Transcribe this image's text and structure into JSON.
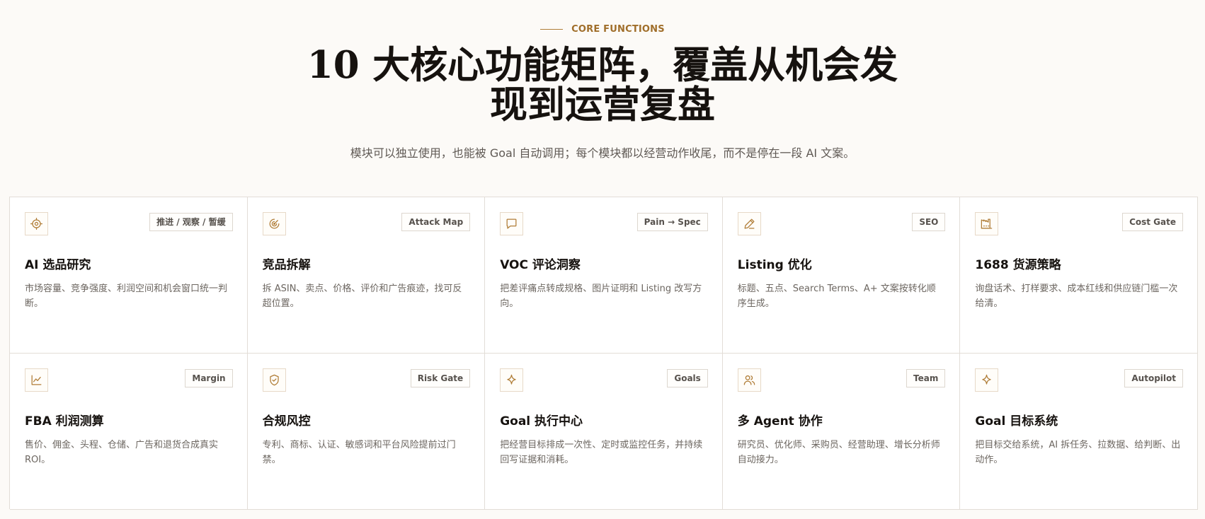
{
  "section": {
    "eyebrow": "CORE FUNCTIONS",
    "title_line1": "10 大核心功能矩阵，覆盖从机会发",
    "title_line2": "现到运营复盘",
    "subtitle": "模块可以独立使用，也能被 Goal 自动调用；每个模块都以经营动作收尾，而不是停在一段 AI 文案。"
  },
  "colors": {
    "accent": "#b07d37",
    "background": "#fcfaf7",
    "border": "#e2ddd7"
  },
  "cards": [
    {
      "title": "AI 选品研究",
      "badge": "推进 / 观察 / 暂缓",
      "desc": "市场容量、竞争强度、利润空间和机会窗口统一判断。",
      "icon": "target-icon"
    },
    {
      "title": "竞品拆解",
      "badge": "Attack Map",
      "desc": "拆 ASIN、卖点、价格、评价和广告痕迹，找可反超位置。",
      "icon": "radar-icon"
    },
    {
      "title": "VOC 评论洞察",
      "badge": "Pain → Spec",
      "desc": "把差评痛点转成规格、图片证明和 Listing 改写方向。",
      "icon": "chat-bubble-icon"
    },
    {
      "title": "Listing 优化",
      "badge": "SEO",
      "desc": "标题、五点、Search Terms、A+ 文案按转化顺序生成。",
      "icon": "pen-icon"
    },
    {
      "title": "1688 货源策略",
      "badge": "Cost Gate",
      "desc": "询盘话术、打样要求、成本红线和供应链门槛一次给清。",
      "icon": "factory-icon"
    },
    {
      "title": "FBA 利润测算",
      "badge": "Margin",
      "desc": "售价、佣金、头程、仓储、广告和退货合成真实 ROI。",
      "icon": "line-chart-icon"
    },
    {
      "title": "合规风控",
      "badge": "Risk Gate",
      "desc": "专利、商标、认证、敏感词和平台风险提前过门禁。",
      "icon": "shield-check-icon"
    },
    {
      "title": "Goal 执行中心",
      "badge": "Goals",
      "desc": "把经营目标排成一次性、定时或监控任务，并持续回写证据和消耗。",
      "icon": "sparkle-icon"
    },
    {
      "title": "多 Agent 协作",
      "badge": "Team",
      "desc": "研究员、优化师、采购员、经营助理、增长分析师自动接力。",
      "icon": "users-icon"
    },
    {
      "title": "Goal 目标系统",
      "badge": "Autopilot",
      "desc": "把目标交给系统，AI 拆任务、拉数据、给判断、出动作。",
      "icon": "sparkle-icon"
    }
  ]
}
